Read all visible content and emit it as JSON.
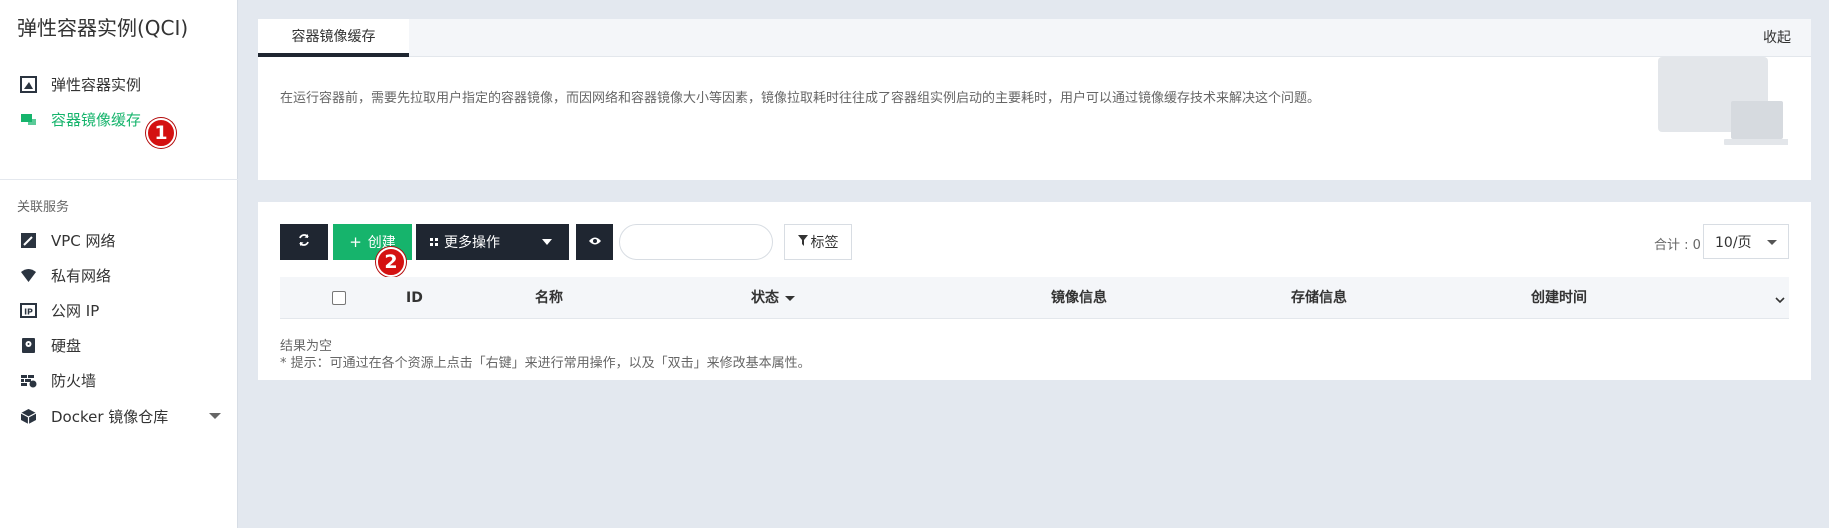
{
  "app_title": "弹性容器实例(QCI)",
  "sidebar": {
    "items": [
      {
        "label": "弹性容器实例",
        "icon": "container-instance-icon"
      },
      {
        "label": "容器镜像缓存",
        "icon": "image-cache-icon"
      }
    ],
    "section_label": "关联服务",
    "related": [
      {
        "label": "VPC 网络",
        "icon": "vpc-icon"
      },
      {
        "label": "私有网络",
        "icon": "wifi-icon"
      },
      {
        "label": "公网 IP",
        "icon": "ip-icon"
      },
      {
        "label": "硬盘",
        "icon": "disk-icon"
      },
      {
        "label": "防火墙",
        "icon": "firewall-icon"
      },
      {
        "label": "Docker 镜像仓库",
        "icon": "docker-icon"
      }
    ]
  },
  "badges": {
    "one": "1",
    "two": "2"
  },
  "tabs": {
    "active": "容器镜像缓存",
    "collapse": "收起"
  },
  "intro": {
    "text": "在运行容器前，需要先拉取用户指定的容器镜像，而因网络和容器镜像大小等因素，镜像拉取耗时往往成了容器组实例启动的主要耗时，用户可以通过镜像缓存技术来解决这个问题。"
  },
  "toolbar": {
    "create": "创建",
    "more": "更多操作",
    "search_placeholder": "",
    "tag": "标签",
    "total": "合计 : 0",
    "page_size": "10/页"
  },
  "table": {
    "columns": [
      "ID",
      "名称",
      "状态",
      "镜像信息",
      "存储信息",
      "创建时间"
    ],
    "empty": "结果为空",
    "hint": "* 提示：可通过在各个资源上点击「右键」来进行常用操作，以及「双击」来修改基本属性。"
  },
  "colors": {
    "accent": "#16b46c",
    "dark": "#1f2631",
    "badge": "#d41111"
  }
}
